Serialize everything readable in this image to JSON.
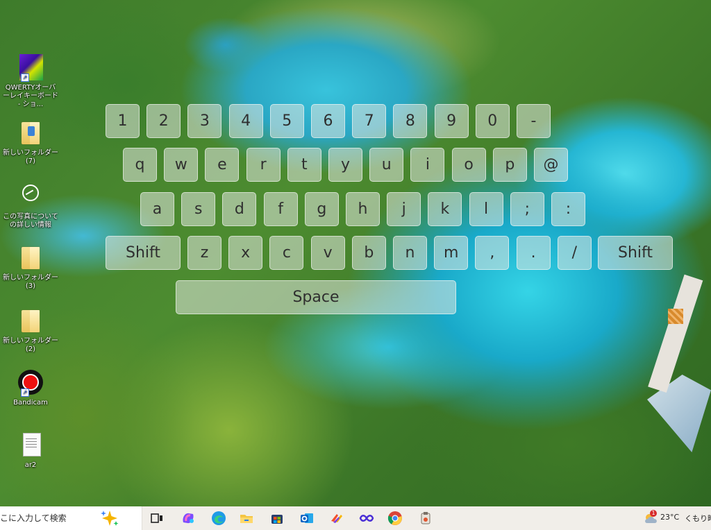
{
  "desktop_icons": [
    {
      "label": "QWERTYオーバーレイキーボード - ショ..."
    },
    {
      "label": "新しいフォルダー (7)"
    },
    {
      "label": "この写真についての詳しい情報"
    },
    {
      "label": "新しいフォルダー (3)"
    },
    {
      "label": "新しいフォルダー (2)"
    },
    {
      "label": "Bandicam"
    },
    {
      "label": "ar2"
    }
  ],
  "keyboard": {
    "row1": [
      "1",
      "2",
      "3",
      "4",
      "5",
      "6",
      "7",
      "8",
      "9",
      "0",
      "-"
    ],
    "row2": [
      "q",
      "w",
      "e",
      "r",
      "t",
      "y",
      "u",
      "i",
      "o",
      "p",
      "@"
    ],
    "row3": [
      "a",
      "s",
      "d",
      "f",
      "g",
      "h",
      "j",
      "k",
      "l",
      ";",
      ":"
    ],
    "row4_shift_left": "Shift",
    "row4": [
      "z",
      "x",
      "c",
      "v",
      "b",
      "n",
      "m",
      ",",
      ".",
      "/"
    ],
    "row4_shift_right": "Shift",
    "space": "Space"
  },
  "taskbar": {
    "search_placeholder": "こに入力して検索",
    "apps": [
      "task-view-icon",
      "copilot-icon",
      "edge-icon",
      "file-explorer-icon",
      "microsoft-store-icon",
      "outlook-icon",
      "app-icon-1",
      "app-icon-2",
      "chrome-icon",
      "app-icon-3"
    ],
    "weather": {
      "temp": "23°C",
      "condition": "くもり時",
      "badge": "1"
    }
  },
  "colors": {
    "key_bg": "#e1e8e0",
    "taskbar_bg": "#f1eee9"
  }
}
